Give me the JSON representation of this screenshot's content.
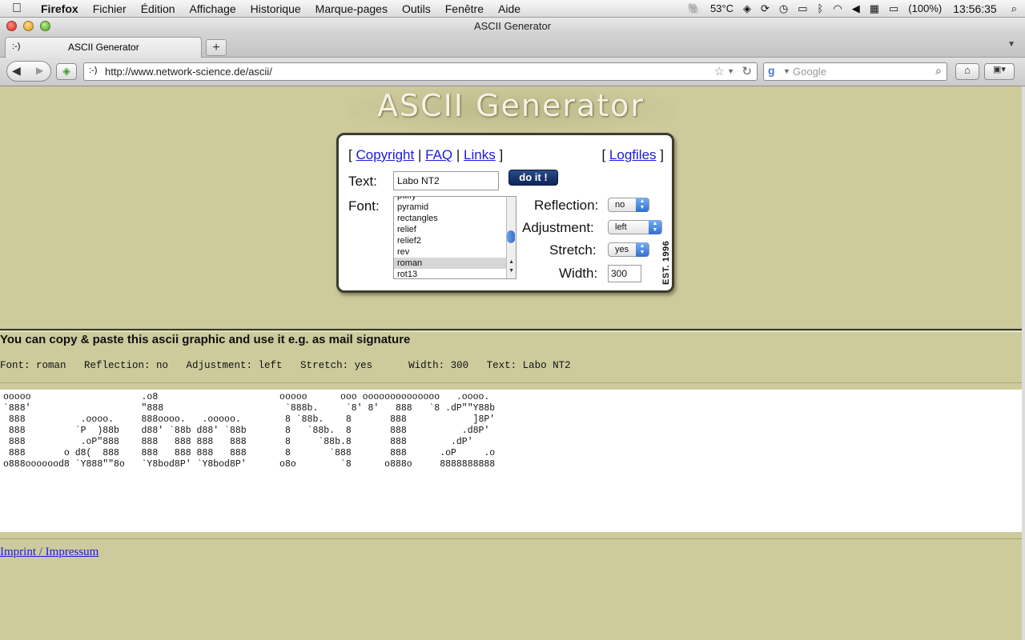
{
  "menubar": {
    "apple": "",
    "items": [
      "Firefox",
      "Fichier",
      "Édition",
      "Affichage",
      "Historique",
      "Marque-pages",
      "Outils",
      "Fenêtre",
      "Aide"
    ],
    "status": {
      "temp": "53°C",
      "battery": "(100%)",
      "clock": "13:56:35"
    }
  },
  "window": {
    "title": "ASCII Generator"
  },
  "tabs": [
    {
      "favicon": ":-)",
      "title": "ASCII Generator"
    }
  ],
  "toolbar": {
    "new_tab": "+",
    "url_favicon": ":-)",
    "url": "http://www.network-science.de/ascii/",
    "search_placeholder": "Google"
  },
  "page": {
    "logo": "ASCII Generator",
    "links_left": {
      "open": "[",
      "copyright": "Copyright",
      "sep1": "|",
      "faq": "FAQ",
      "sep2": "|",
      "links": "Links",
      "close": "]"
    },
    "links_right": {
      "open": "[",
      "logfiles": "Logfiles",
      "close": "]"
    },
    "text_label": "Text:",
    "text_value": "Labo NT2",
    "doit": "do it !",
    "font_label": "Font:",
    "fonts": [
      "puffy",
      "pyramid",
      "rectangles",
      "relief",
      "relief2",
      "rev",
      "roman",
      "rot13"
    ],
    "selected_font": "roman",
    "reflection_label": "Reflection:",
    "reflection_value": "no",
    "adjustment_label": "Adjustment:",
    "adjustment_value": "left",
    "stretch_label": "Stretch:",
    "stretch_value": "yes",
    "width_label": "Width:",
    "width_value": "300",
    "est": "EST. 1996",
    "headline": "You can copy & paste this ascii graphic and use it e.g. as mail signature",
    "settings_line": "Font: roman   Reflection: no   Adjustment: left   Stretch: yes      Width: 300   Text: Labo NT2",
    "ascii_art": "ooooo                    .o8                      ooooo      ooo oooooooooooooo   .oooo.\n`888'                    \"888                      `888b.     `8' 8'   888   `8 .dP\"\"Y88b\n 888          .oooo.     888oooo.   .ooooo.        8 `88b.    8       888            ]8P'\n 888         `P  )88b    d88' `88b d88' `88b       8   `88b.  8       888          .d8P'\n 888          .oP\"888    888   888 888   888       8     `88b.8       888        .dP'\n 888       o d8(  888    888   888 888   888       8       `888       888      .oP     .o\no888ooooood8 `Y888\"\"8o   `Y8bod8P' `Y8bod8P'      o8o        `8      o888o     8888888888",
    "imprint": "Imprint / Impressum"
  },
  "colors": {
    "page_bg": "#cdcb9c",
    "link": "#1a1ae0",
    "button": "#0b2558"
  }
}
